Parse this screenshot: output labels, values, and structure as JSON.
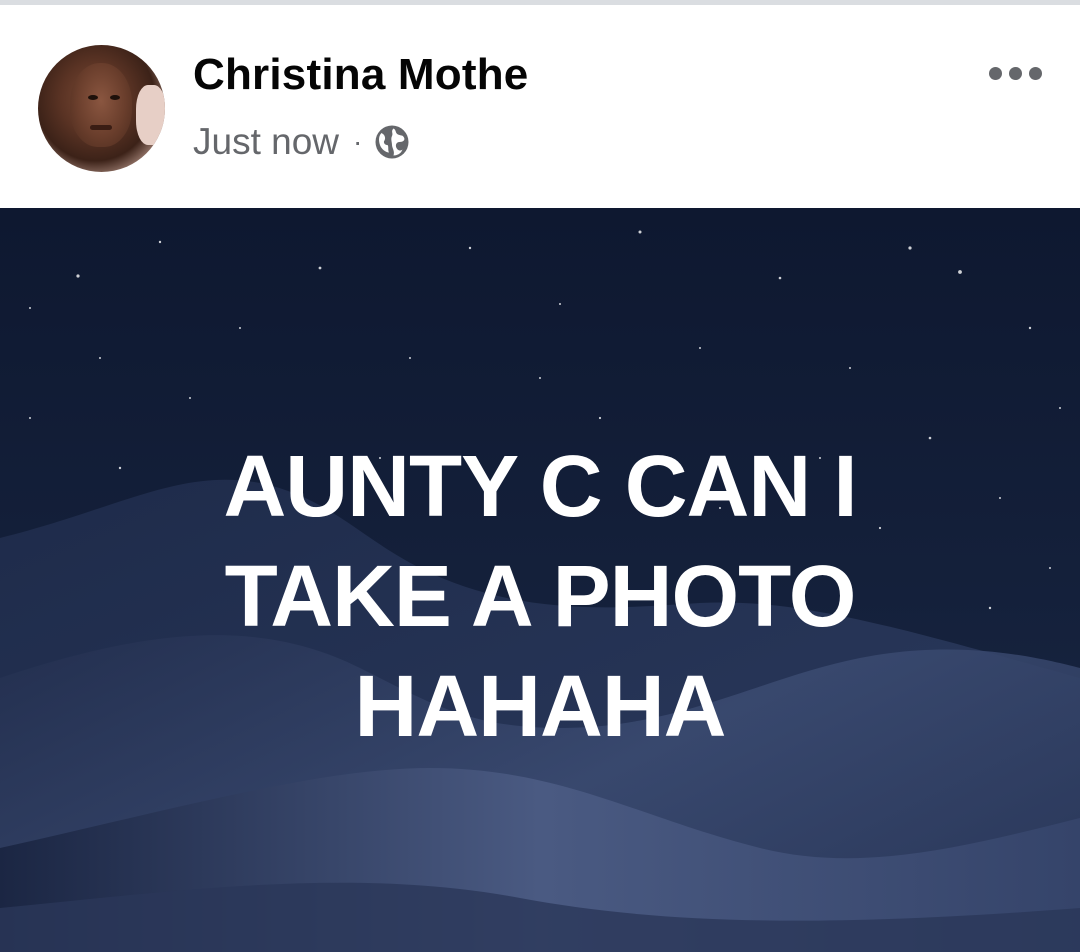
{
  "post": {
    "author_name": "Christina Mothe",
    "timestamp": "Just now",
    "separator": "·",
    "audience_icon": "globe-icon",
    "more_icon": "more-options-icon",
    "avatar": "profile-photo",
    "background": "night-desert-dunes",
    "text": "AUNTY C CAN I\nTAKE A PHOTO\nHAHAHA"
  },
  "colors": {
    "name": "#050505",
    "meta": "#65676b",
    "post_text": "#ffffff",
    "post_bg": "#17243f"
  }
}
